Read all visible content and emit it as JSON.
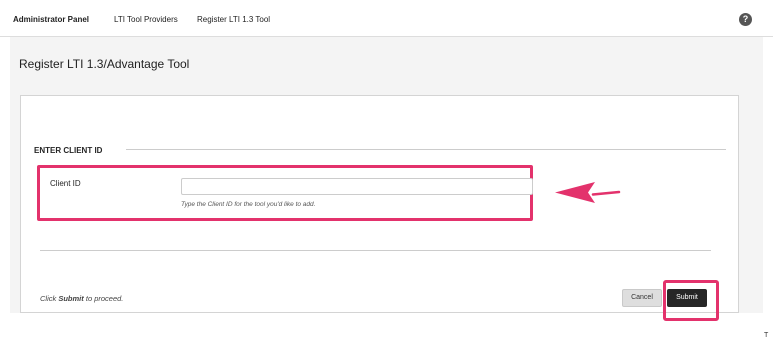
{
  "breadcrumb": {
    "items": [
      "Administrator Panel",
      "LTI Tool Providers",
      "Register LTI 1.3 Tool"
    ]
  },
  "help_icon": {
    "glyph": "?"
  },
  "page": {
    "title": "Register LTI 1.3/Advantage Tool"
  },
  "form": {
    "section_heading": "ENTER CLIENT ID",
    "client_id_label": "Client ID",
    "client_id_value": "",
    "client_id_hint": "Type the Client ID for the tool you'd like to add.",
    "proceed_prefix": "Click",
    "proceed_strong": "Submit",
    "proceed_suffix": "to proceed.",
    "cancel_label": "Cancel",
    "submit_label": "Submit"
  },
  "annotations": {
    "highlight_color": "#e3326c",
    "arrow_icon": "arrow-left-icon"
  },
  "corner_text": "T"
}
